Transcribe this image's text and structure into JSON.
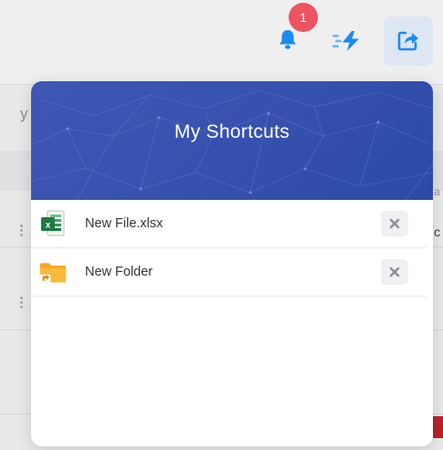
{
  "topbar": {
    "notification_count": "1",
    "icons": {
      "bell": "bell-icon",
      "quick_actions": "lightning-icon",
      "share": "share-arrow-icon"
    },
    "colors": {
      "accent": "#1a8bf2",
      "badge": "#ec5461",
      "share_button_bg": "#dde6f3"
    }
  },
  "background": {
    "fragments": [
      "y",
      "a",
      "c"
    ]
  },
  "shortcuts_panel": {
    "title": "My Shortcuts",
    "header_color": "#3651ad",
    "items": [
      {
        "name": "New File.xlsx",
        "icon": "excel-file-icon"
      },
      {
        "name": "New Folder",
        "icon": "folder-shortcut-icon"
      }
    ],
    "remove_icon": "close-icon"
  }
}
